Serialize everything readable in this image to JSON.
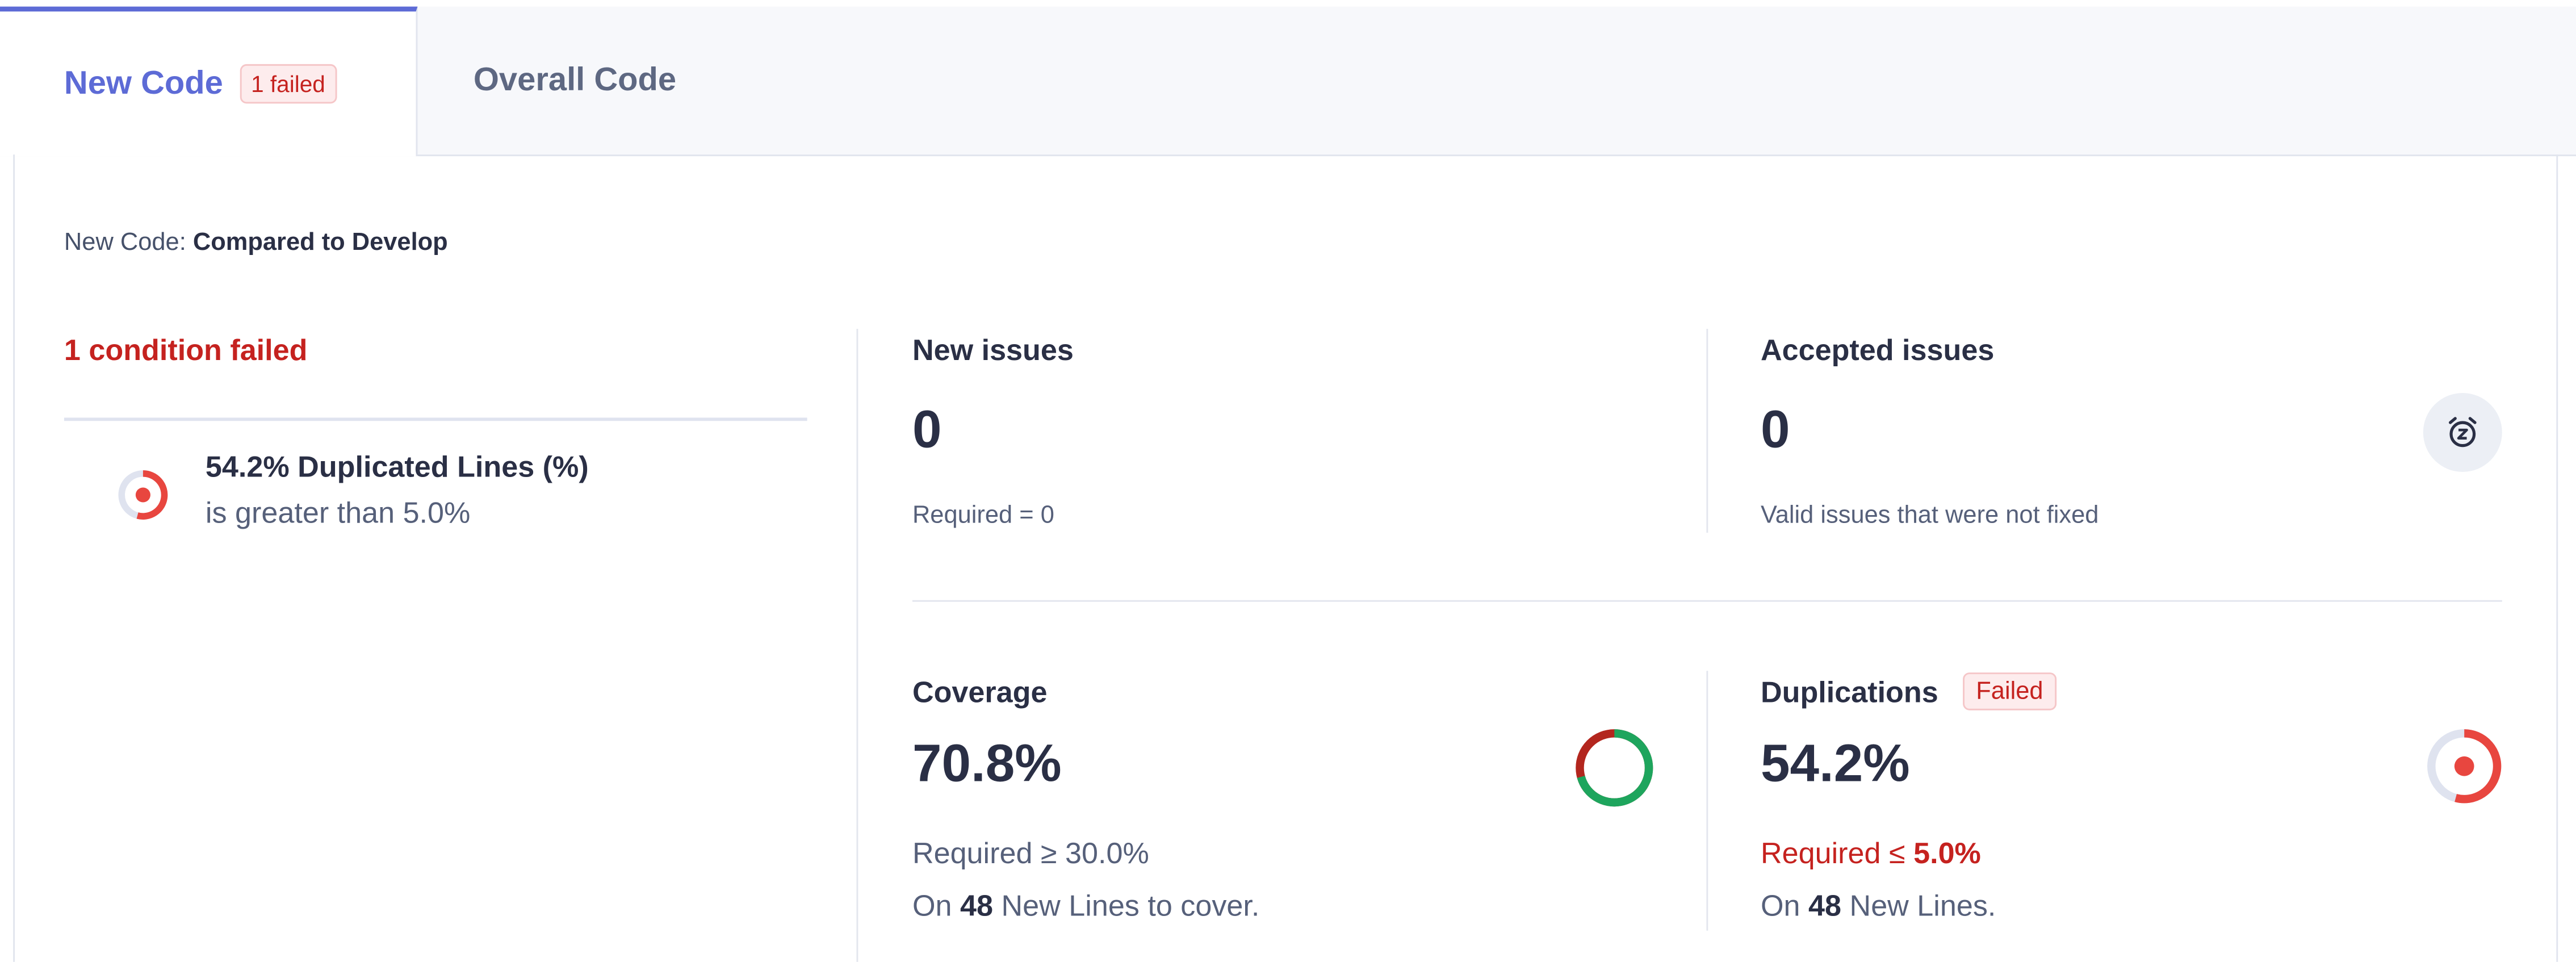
{
  "tabs": {
    "new_code": {
      "label": "New Code",
      "badge": "1 failed"
    },
    "overall_code": {
      "label": "Overall Code"
    }
  },
  "reference": {
    "prefix": "New Code:",
    "value": "Compared to Develop"
  },
  "conditions": {
    "title": "1 condition failed",
    "items": [
      {
        "title": "54.2% Duplicated Lines (%)",
        "subtitle": "is greater than 5.0%",
        "icon": "duplication-ring-icon",
        "value_percent": 54.2
      }
    ]
  },
  "metrics": {
    "new_issues": {
      "title": "New issues",
      "value": "0",
      "note": "Required = 0"
    },
    "accepted_issues": {
      "title": "Accepted issues",
      "value": "0",
      "note": "Valid issues that were not fixed",
      "icon": "snooze-clock-icon"
    },
    "coverage": {
      "title": "Coverage",
      "value": "70.8%",
      "value_percent": 70.8,
      "required_text": "Required ≥ 30.0%",
      "lines_prefix": "On",
      "lines_count": "48",
      "lines_suffix": "New Lines to cover.",
      "icon": "coverage-donut-icon"
    },
    "duplications": {
      "title": "Duplications",
      "badge": "Failed",
      "value": "54.2%",
      "value_percent": 54.2,
      "required_prefix": "Required ≤",
      "required_value": "5.0%",
      "lines_prefix": "On",
      "lines_count": "48",
      "lines_suffix": "New Lines.",
      "icon": "duplication-ring-icon"
    }
  },
  "colors": {
    "accent": "#5d6bd6",
    "error": "#c5221f",
    "success": "#1ea55d",
    "ring_red": "#e8463f",
    "ring_track": "#dfe3ef"
  }
}
